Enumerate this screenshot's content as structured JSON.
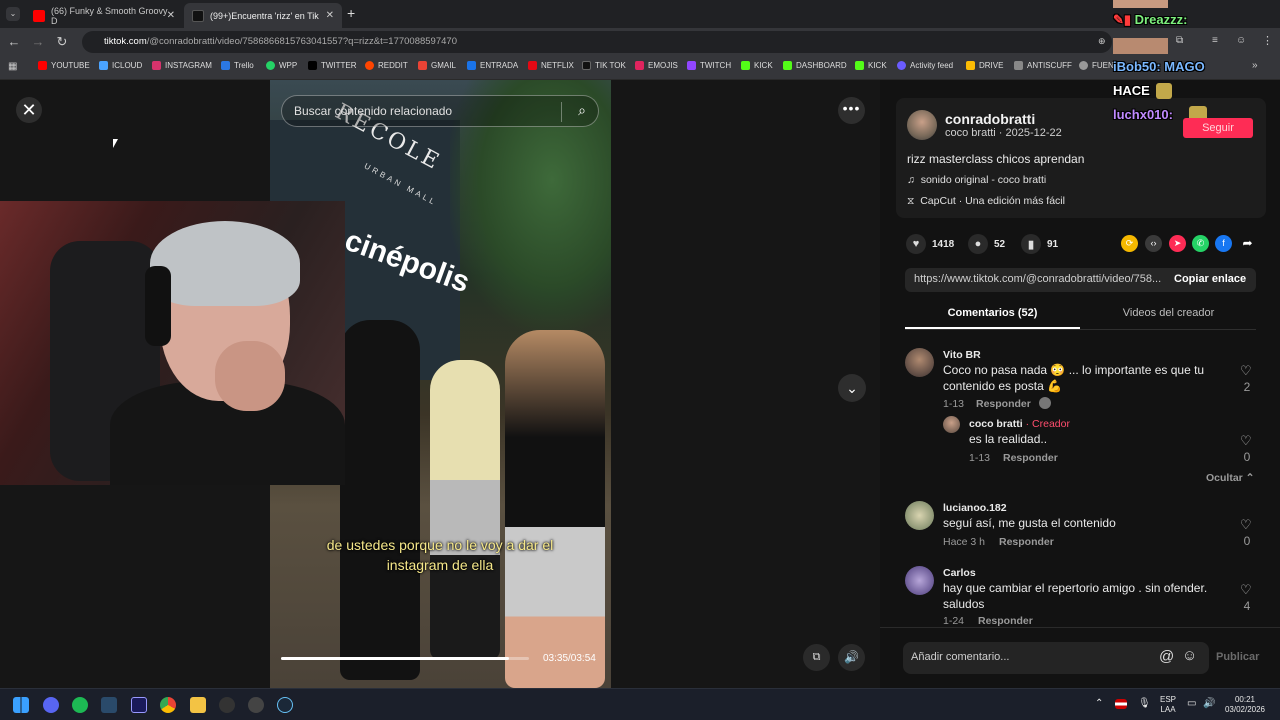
{
  "browser": {
    "tabs": [
      {
        "label": "(66) Funky & Smooth Groovy D",
        "favicon_color": "#ff0000"
      },
      {
        "label": "(99+)Encuentra 'rizz' en Tik",
        "favicon_color": "#111111"
      }
    ],
    "new_tab": "+",
    "url_host": "tiktok.com",
    "url_rest": "/@conradobratti/video/7586866815763041557?q=rizz&t=1770088597470",
    "bookmarks": [
      "YOUTUBE",
      "ICLOUD",
      "INSTAGRAM",
      "Trello",
      "WPP",
      "TWITTER",
      "REDDIT",
      "GMAIL",
      "ENTRADA",
      "NETFLIX",
      "TIK TOK",
      "EMOJIS",
      "TWITCH",
      "KICK",
      "DASHBOARD",
      "KICK",
      "Activity feed",
      "DRIVE",
      "ANTISCUFF",
      "FUEN"
    ]
  },
  "video": {
    "search_placeholder": "Buscar contenido relacionado",
    "subtitle_line1": "de ustedes porque no le voy a dar el",
    "subtitle_line2": "instagram de ella",
    "time": "03:35/03:54",
    "progress": 0.92,
    "sign_top": "RECOLE",
    "sign_sub": "URBAN MALL",
    "sign_brand": "cinépolis"
  },
  "post": {
    "author": "conradobratti",
    "author_sub": "coco bratti · 2025-12-22",
    "description": "rizz masterclass chicos aprendan",
    "sound": "sonido original - coco bratti",
    "capcut": "CapCut · Una edición más fácil",
    "likes": "1418",
    "comments": "52",
    "saves": "91",
    "link": "https://www.tiktok.com/@conradobratti/video/758...",
    "copy_link": "Copiar enlace",
    "follow": "Seguir"
  },
  "tabs": {
    "comments": "Comentarios (52)",
    "creator": "Videos del creador"
  },
  "comments": [
    {
      "name": "Vito BR",
      "text1": "Coco no pasa nada 😳 ... lo importante es que tu",
      "text2": "contenido es posta 💪",
      "date": "1-13",
      "reply": "Responder",
      "likes": "2"
    },
    {
      "name": "coco bratti",
      "creator": "· Creador",
      "text1": "es la realidad..",
      "date": "1-13",
      "reply": "Responder",
      "likes": "0"
    },
    {
      "name": "lucianoo.182",
      "text1": "seguí así, me gusta el contenido",
      "date": "Hace 3 h",
      "reply": "Responder",
      "likes": "0"
    },
    {
      "name": "Carlos",
      "text1": "hay que cambiar el repertorio amigo . sin ofender.",
      "text2": "saludos",
      "date": "1-24",
      "reply": "Responder",
      "likes": "4"
    }
  ],
  "hide_replies": "Ocultar ⌃",
  "comment_input": {
    "placeholder": "Añadir comentario...",
    "publish": "Publicar"
  },
  "chat": {
    "line1": "Dreazzz:",
    "line2": "iBob50: MAGO",
    "line3": "HACE",
    "line4": "luchx010:"
  },
  "taskbar": {
    "lang1": "ESP",
    "lang2": "LAA",
    "time": "00:21",
    "date": "03/02/2026"
  }
}
